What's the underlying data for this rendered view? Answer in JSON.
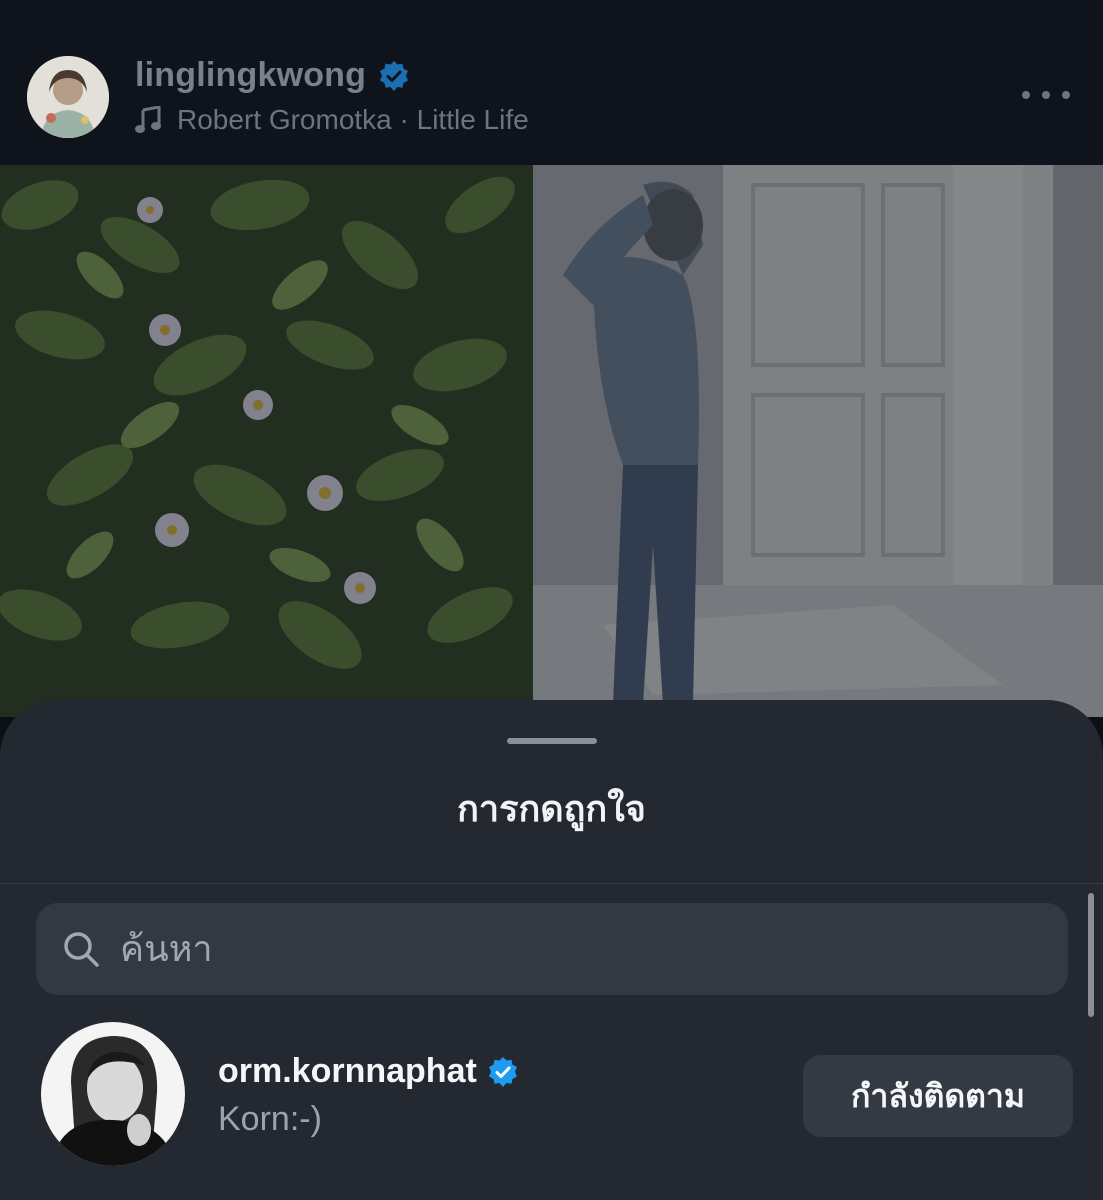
{
  "post": {
    "username": "linglingkwong",
    "verified": true,
    "audio": "Robert Gromotka · Little Life",
    "more_icon": "ellipsis-horizontal-icon"
  },
  "likes_sheet": {
    "title": "การกดถูกใจ",
    "search": {
      "placeholder": "ค้นหา",
      "value": ""
    },
    "users": [
      {
        "username": "orm.kornnaphat",
        "verified": true,
        "subtitle": "Korn:-)",
        "follow_label": "กำลังติดตาม"
      }
    ]
  },
  "colors": {
    "verified_badge": "#1d9bf0",
    "sheet_background": "#232831",
    "search_background": "#333943",
    "button_background": "#343a44"
  }
}
